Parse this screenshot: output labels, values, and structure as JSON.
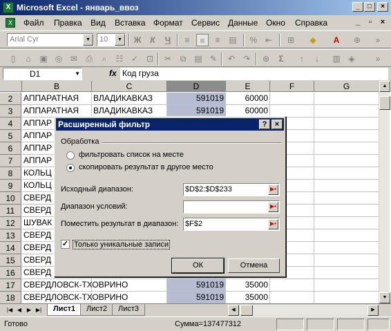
{
  "window": {
    "title": "Microsoft Excel - январь_ввоз",
    "minimize": "_",
    "maximize": "□",
    "close": "×"
  },
  "menu": [
    "Файл",
    "Правка",
    "Вид",
    "Вставка",
    "Формат",
    "Сервис",
    "Данные",
    "Окно",
    "Справка"
  ],
  "toolbar": {
    "font": "Arial Cyr",
    "size": "10"
  },
  "formula_bar": {
    "name_box": "D1",
    "fx": "fx",
    "value": "Код груза"
  },
  "columns": [
    "B",
    "C",
    "D",
    "E",
    "F",
    "G"
  ],
  "rows": [
    {
      "n": "2",
      "b": "АППАРАТНАЯ",
      "c": "ВЛАДИКАВКАЗ",
      "d": "591019",
      "e": "60000"
    },
    {
      "n": "3",
      "b": "АППАРАТНАЯ",
      "c": "ВЛАДИКАВКАЗ",
      "d": "591019",
      "e": "60000"
    },
    {
      "n": "4",
      "b": "АППАР",
      "c": "",
      "d": "",
      "e": ""
    },
    {
      "n": "5",
      "b": "АППАР",
      "c": "",
      "d": "",
      "e": ""
    },
    {
      "n": "6",
      "b": "АППАР",
      "c": "",
      "d": "",
      "e": ""
    },
    {
      "n": "7",
      "b": "АППАР",
      "c": "",
      "d": "",
      "e": ""
    },
    {
      "n": "8",
      "b": "КОЛЬЦ",
      "c": "",
      "d": "",
      "e": ""
    },
    {
      "n": "9",
      "b": "КОЛЬЦ",
      "c": "",
      "d": "",
      "e": ""
    },
    {
      "n": "10",
      "b": "СВЕРД",
      "c": "",
      "d": "",
      "e": ""
    },
    {
      "n": "11",
      "b": "СВЕРД",
      "c": "",
      "d": "",
      "e": ""
    },
    {
      "n": "12",
      "b": "ШУВАК",
      "c": "",
      "d": "",
      "e": ""
    },
    {
      "n": "13",
      "b": "СВЕРД",
      "c": "",
      "d": "",
      "e": ""
    },
    {
      "n": "14",
      "b": "СВЕРД",
      "c": "",
      "d": "",
      "e": ""
    },
    {
      "n": "15",
      "b": "СВЕРД",
      "c": "",
      "d": "",
      "e": ""
    },
    {
      "n": "16",
      "b": "СВЕРД",
      "c": "",
      "d": "",
      "e": ""
    },
    {
      "n": "17",
      "b": "СВЕРДЛОВСК-ТХОВРИНО",
      "c": "",
      "d": "591019",
      "e": "35000"
    },
    {
      "n": "18",
      "b": "СВЕРДЛОВСК-ТХОВРИНО",
      "c": "",
      "d": "591019",
      "e": "35000"
    }
  ],
  "sheet_tabs": [
    "Лист1",
    "Лист2",
    "Лист3"
  ],
  "status": {
    "ready": "Готово",
    "sum": "Сумма=137477312"
  },
  "dialog": {
    "title": "Расширенный фильтр",
    "help": "?",
    "close": "×",
    "group": "Обработка",
    "radio1": "фильтровать список на месте",
    "radio2": "скопировать результат в другое место",
    "source_label": "Исходный диапазон:",
    "source_value": "$D$2:$D$233",
    "criteria_label": "Диапазон условий:",
    "criteria_value": "",
    "dest_label": "Поместить результат в диапазон:",
    "dest_value": "$F$2",
    "unique_label": "Только уникальные записи",
    "ok": "ОК",
    "cancel": "Отмена"
  }
}
